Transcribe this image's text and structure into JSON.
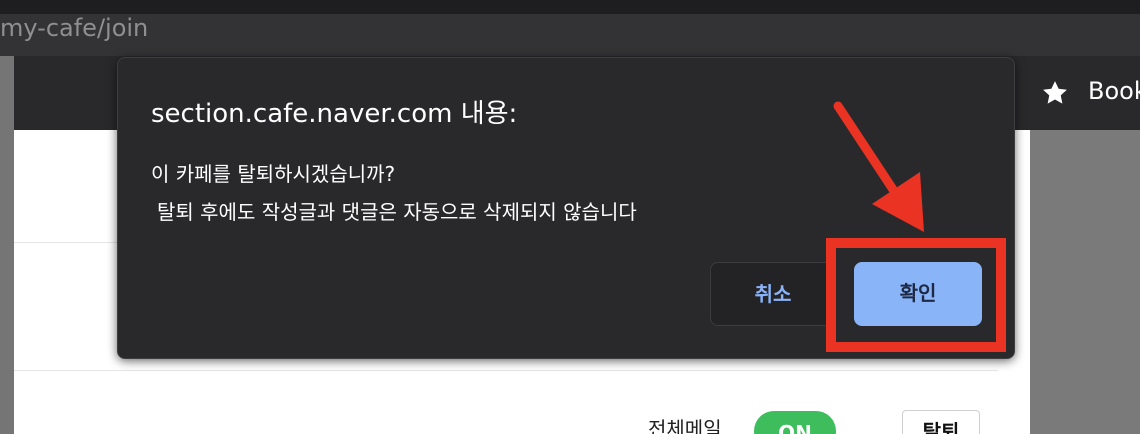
{
  "browser": {
    "url_fragment": "my-cafe/join",
    "bookmarks_label": "Book",
    "star_icon": "star-icon"
  },
  "page": {
    "mail_label": "전체메일",
    "toggle_label": "ON",
    "leave_button_label": "탈퇴"
  },
  "dialog": {
    "title": "section.cafe.naver.com 내용:",
    "message_line_1": "이 카페를 탈퇴하시겠습니까?",
    "message_line_2": "탈퇴 후에도 작성글과 댓글은 자동으로 삭제되지 않습니다",
    "cancel_label": "취소",
    "ok_label": "확인"
  },
  "annotation": {
    "highlight_color": "#ea3323"
  },
  "colors": {
    "dialog_bg": "#29292c",
    "ok_button": "#8ab4f8",
    "toggle_on": "#3dbd5b"
  }
}
